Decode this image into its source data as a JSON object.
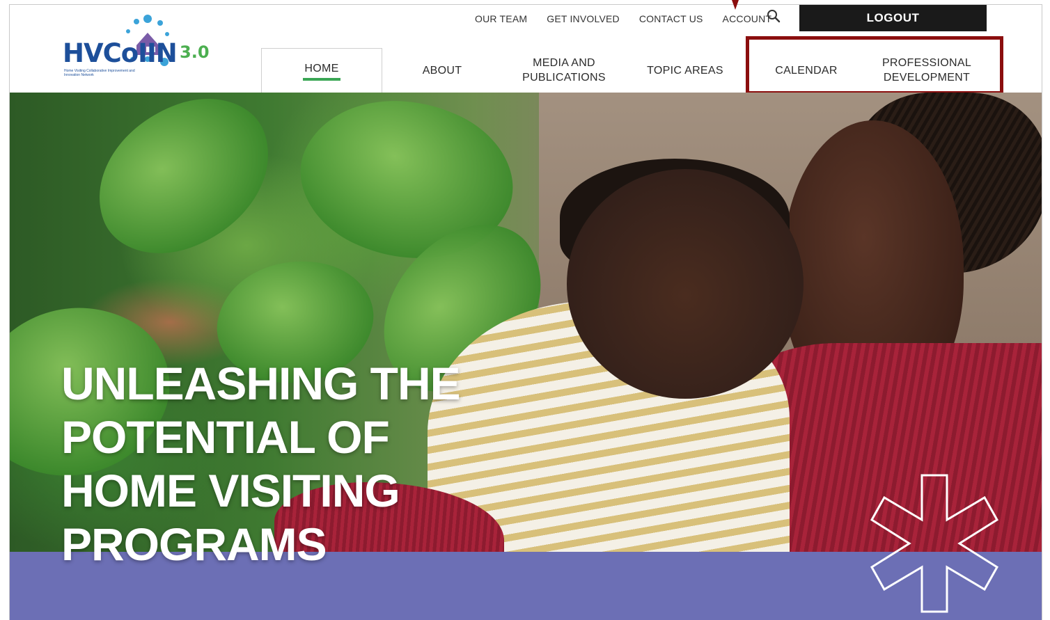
{
  "logo": {
    "name": "HVCoIIN",
    "version": "3.0",
    "tagline": "Home Visiting Collaborative Improvement and Innovation Network"
  },
  "utility_nav": {
    "items": [
      "OUR TEAM",
      "GET INVOLVED",
      "CONTACT US",
      "ACCOUNT"
    ],
    "search_icon": "search-icon",
    "logout_label": "LOGOUT"
  },
  "main_nav": {
    "items": [
      {
        "label": "HOME",
        "active": true
      },
      {
        "label": "ABOUT"
      },
      {
        "label_line1": "MEDIA AND",
        "label_line2": "PUBLICATIONS"
      },
      {
        "label": "TOPIC AREAS"
      },
      {
        "label": "CALENDAR"
      },
      {
        "label_line1": "PROFESSIONAL",
        "label_line2": "DEVELOPMENT"
      }
    ]
  },
  "hero": {
    "headline_lines": [
      "UNLEASHING THE",
      "POTENTIAL OF",
      "HOME VISITING",
      "PROGRAMS"
    ]
  },
  "colors": {
    "logo_blue": "#1d4f9a",
    "logo_green": "#4caf50",
    "active_underline": "#3aa655",
    "logout_bg": "#1a1a1a",
    "highlight_box": "#8b0e0e",
    "hero_band": "#6c6fb5"
  }
}
